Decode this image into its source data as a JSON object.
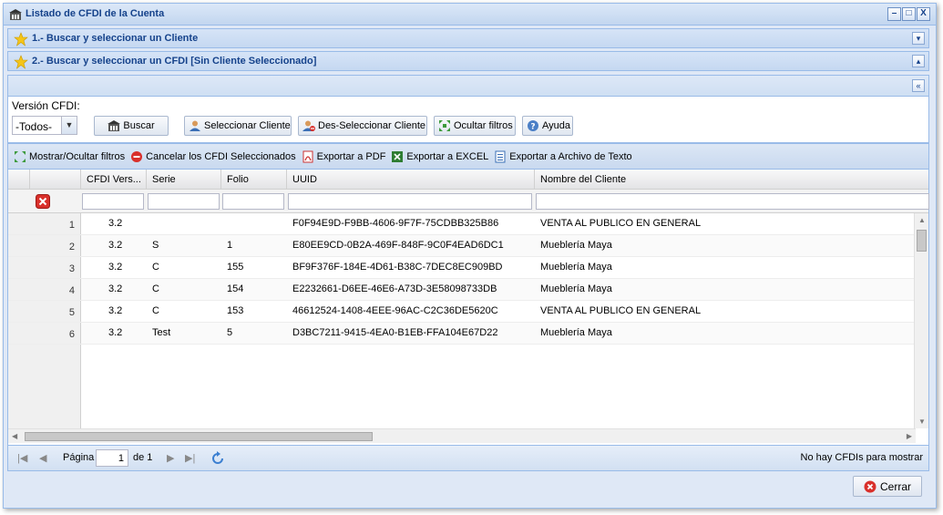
{
  "window": {
    "title": "Listado de CFDI de la Cuenta",
    "tools": [
      "–",
      "□",
      "X"
    ]
  },
  "accordion": [
    {
      "title": "1.- Buscar y seleccionar un Cliente",
      "tool": "▾"
    },
    {
      "title": "2.- Buscar y seleccionar un CFDI [Sin Cliente Seleccionado]",
      "tool": "▴"
    }
  ],
  "collapse_tool": "«",
  "filters": {
    "version_label": "Versión CFDI:",
    "version_value": "-Todos-",
    "buttons": {
      "buscar": "Buscar",
      "seleccionar": "Seleccionar Cliente",
      "deseleccionar": "Des-Seleccionar Cliente",
      "ocultar": "Ocultar filtros",
      "ayuda": "Ayuda"
    }
  },
  "toolbar": {
    "toggle_filters": "Mostrar/Ocultar filtros",
    "cancel": "Cancelar los CFDI Seleccionados",
    "pdf": "Exportar a PDF",
    "excel": "Exportar a EXCEL",
    "text": "Exportar a Archivo de Texto"
  },
  "columns": {
    "version": "CFDI Vers...",
    "serie": "Serie",
    "folio": "Folio",
    "uuid": "UUID",
    "cliente": "Nombre del Cliente"
  },
  "rows": [
    {
      "n": "1",
      "version": "3.2",
      "serie": "",
      "folio": "",
      "uuid": "F0F94E9D-F9BB-4606-9F7F-75CDBB325B86",
      "cliente": "VENTA AL PUBLICO EN GENERAL"
    },
    {
      "n": "2",
      "version": "3.2",
      "serie": "S",
      "folio": "1",
      "uuid": "E80EE9CD-0B2A-469F-848F-9C0F4EAD6DC1",
      "cliente": "Mueblería Maya"
    },
    {
      "n": "3",
      "version": "3.2",
      "serie": "C",
      "folio": "155",
      "uuid": "BF9F376F-184E-4D61-B38C-7DEC8EC909BD",
      "cliente": "Mueblería Maya"
    },
    {
      "n": "4",
      "version": "3.2",
      "serie": "C",
      "folio": "154",
      "uuid": "E2232661-D6EE-46E6-A73D-3E58098733DB",
      "cliente": "Mueblería Maya"
    },
    {
      "n": "5",
      "version": "3.2",
      "serie": "C",
      "folio": "153",
      "uuid": "46612524-1408-4EEE-96AC-C2C36DE5620C",
      "cliente": "VENTA AL PUBLICO EN GENERAL"
    },
    {
      "n": "6",
      "version": "3.2",
      "serie": "Test",
      "folio": "5",
      "uuid": "D3BC7211-9415-4EA0-B1EB-FFA104E67D22",
      "cliente": "Mueblería Maya"
    }
  ],
  "paging": {
    "page_label": "Página",
    "page_value": "1",
    "of_label": "de 1",
    "status": "No hay CFDIs para mostrar"
  },
  "footer": {
    "close": "Cerrar"
  },
  "colors": {
    "header_text": "#15428b",
    "border": "#99bbe8"
  }
}
